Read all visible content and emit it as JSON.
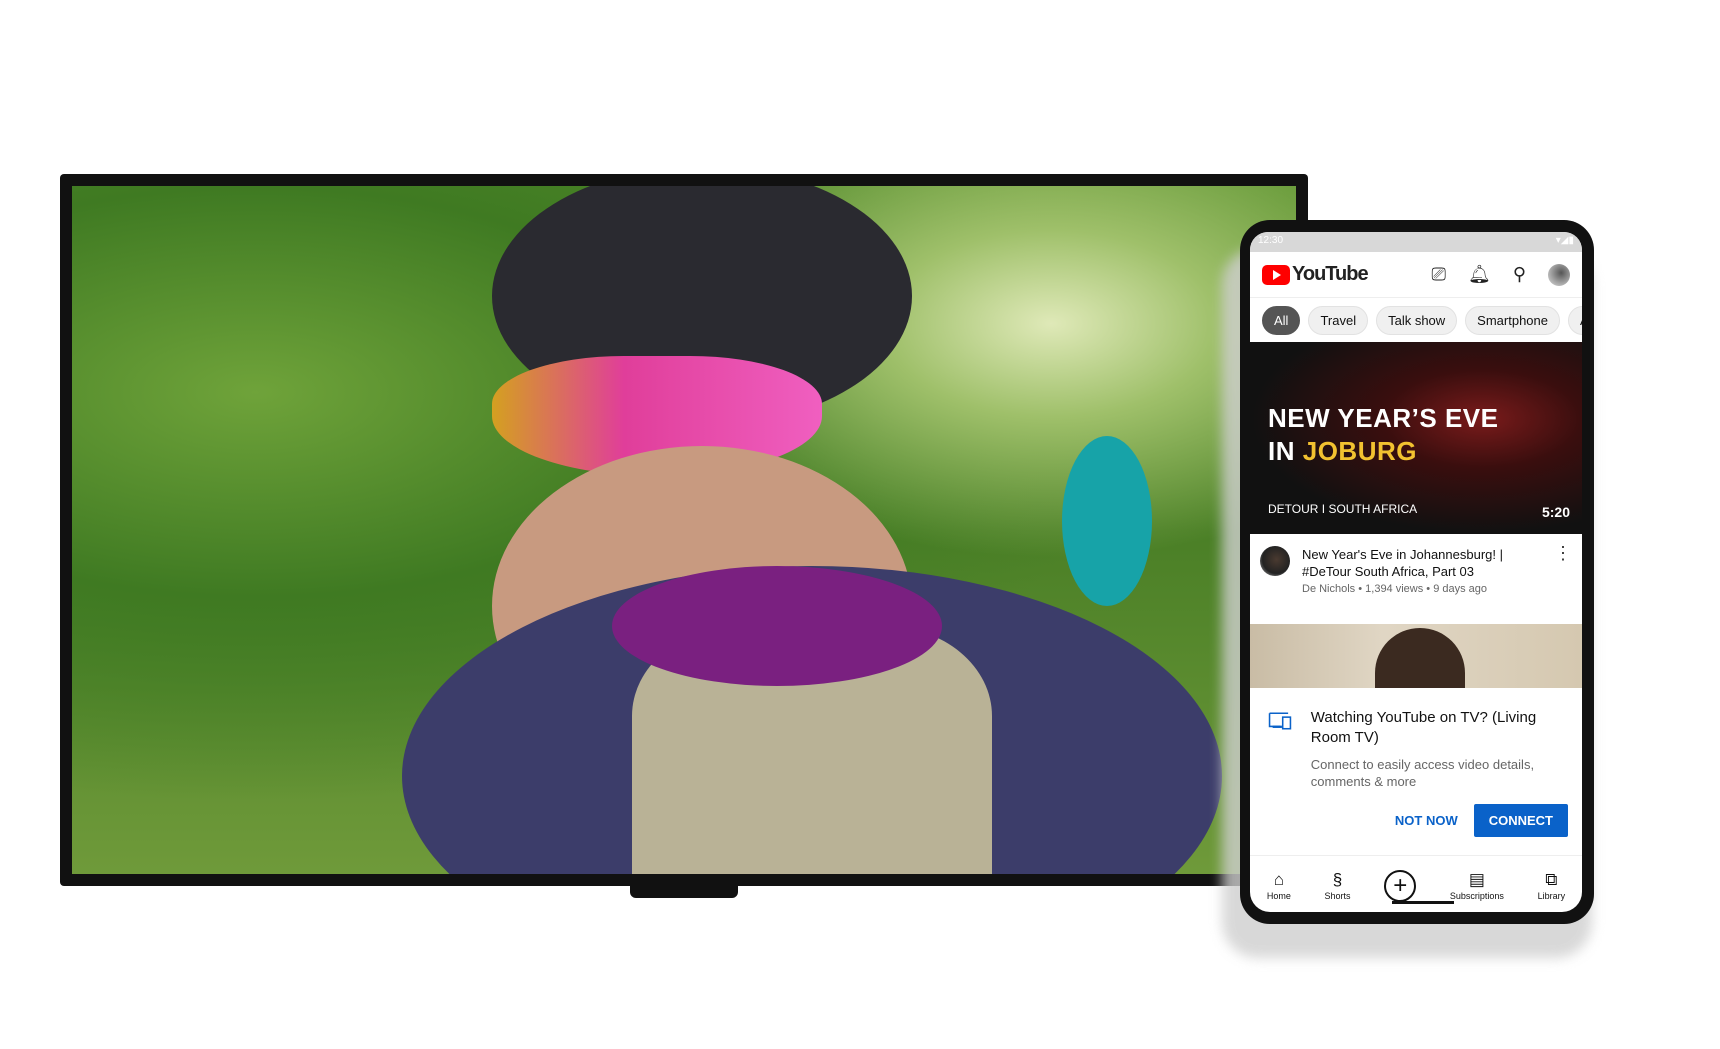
{
  "phone": {
    "status_time": "12:30",
    "app_name": "YouTube",
    "header_icons": [
      "cast-icon",
      "bell-icon",
      "search-icon",
      "avatar"
    ],
    "chips": [
      "All",
      "Travel",
      "Talk show",
      "Smartphone",
      "Ar"
    ],
    "video": {
      "thumb_line1": "NEW YEAR’S EVE",
      "thumb_line2_white": "IN ",
      "thumb_line2_yellow": "JOBURG",
      "thumb_brand": "DETOUR  I  SOUTH AFRICA",
      "duration": "5:20",
      "title": "New Year's Eve in Johannesburg! | #DeTour South Africa, Part 03",
      "meta": "De Nichols • 1,394 views • 9 days ago"
    },
    "dialog": {
      "title": "Watching YouTube on TV? (Living Room TV)",
      "body": "Connect to easily access video details, comments & more",
      "not_now": "NOT NOW",
      "connect": "CONNECT",
      "accent": "#0a62c9"
    },
    "nav": [
      {
        "label": "Home",
        "icon": "home-icon"
      },
      {
        "label": "Shorts",
        "icon": "shorts-icon"
      },
      {
        "label": "",
        "icon": "create-plus-icon"
      },
      {
        "label": "Subscriptions",
        "icon": "subscriptions-icon"
      },
      {
        "label": "Library",
        "icon": "library-icon"
      }
    ]
  }
}
